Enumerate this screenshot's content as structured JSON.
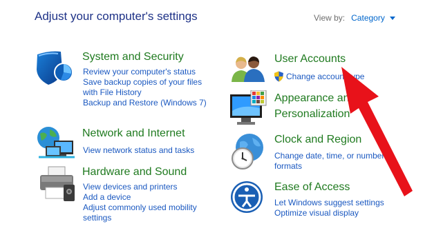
{
  "header": {
    "title": "Adjust your computer's settings",
    "view_by_label": "View by:",
    "view_by_value": "Category"
  },
  "categories": {
    "system_security": {
      "title": "System and Security",
      "links": [
        "Review your computer's status",
        "Save backup copies of your files",
        "with File History",
        "Backup and Restore (Windows 7)"
      ]
    },
    "network": {
      "title": "Network and Internet",
      "links": [
        "View network status and tasks"
      ]
    },
    "hardware": {
      "title": "Hardware and Sound",
      "links": [
        "View devices and printers",
        "Add a device",
        "Adjust commonly used mobility",
        "settings"
      ]
    },
    "user_accounts": {
      "title": "User Accounts",
      "links": [
        "Change account type"
      ]
    },
    "appearance": {
      "title_line1": "Appearance and",
      "title_line2": "Personalization"
    },
    "clock": {
      "title": "Clock and Region",
      "links": [
        "Change date, time, or number",
        "formats"
      ]
    },
    "ease": {
      "title": "Ease of Access",
      "links": [
        "Let Windows suggest settings",
        "Optimize visual display"
      ]
    }
  },
  "colors": {
    "title_blue": "#1e3287",
    "category_green": "#1f7a1f",
    "link_blue": "#1a58c0",
    "annotation_arrow": "#e8121a"
  },
  "icons": {
    "system_security": "shield-icon",
    "network": "globe-network-icon",
    "hardware": "printer-icon",
    "user_accounts": "users-icon",
    "appearance": "monitor-palette-icon",
    "clock": "clock-globe-icon",
    "ease": "accessibility-icon",
    "uac": "uac-shield-icon"
  }
}
